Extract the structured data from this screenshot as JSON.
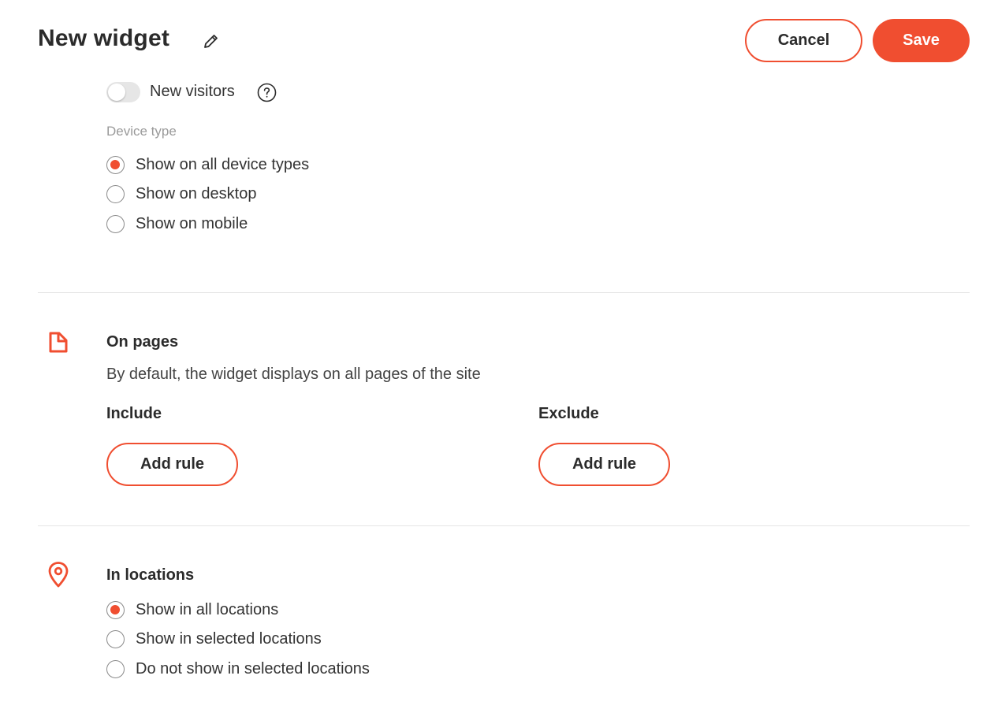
{
  "header": {
    "title": "New widget",
    "cancel_label": "Cancel",
    "save_label": "Save"
  },
  "visitors": {
    "toggle_label": "New visitors",
    "toggle_on": false
  },
  "device_type": {
    "label": "Device type",
    "options": [
      {
        "label": "Show on all device types",
        "selected": true
      },
      {
        "label": "Show on desktop",
        "selected": false
      },
      {
        "label": "Show on mobile",
        "selected": false
      }
    ]
  },
  "on_pages": {
    "icon": "page-icon",
    "title": "On pages",
    "description": "By default, the widget displays on all pages of the site",
    "include_label": "Include",
    "exclude_label": "Exclude",
    "include_button": "Add rule",
    "exclude_button": "Add rule"
  },
  "locations": {
    "icon": "location-pin-icon",
    "title": "In locations",
    "options": [
      {
        "label": "Show in all locations",
        "selected": true
      },
      {
        "label": "Show in selected locations",
        "selected": false
      },
      {
        "label": "Do not show in selected locations",
        "selected": false
      }
    ]
  },
  "colors": {
    "accent": "#f04e30",
    "text": "#2b2b2b",
    "muted": "#9a9a9a",
    "divider": "#e4e4e4"
  }
}
